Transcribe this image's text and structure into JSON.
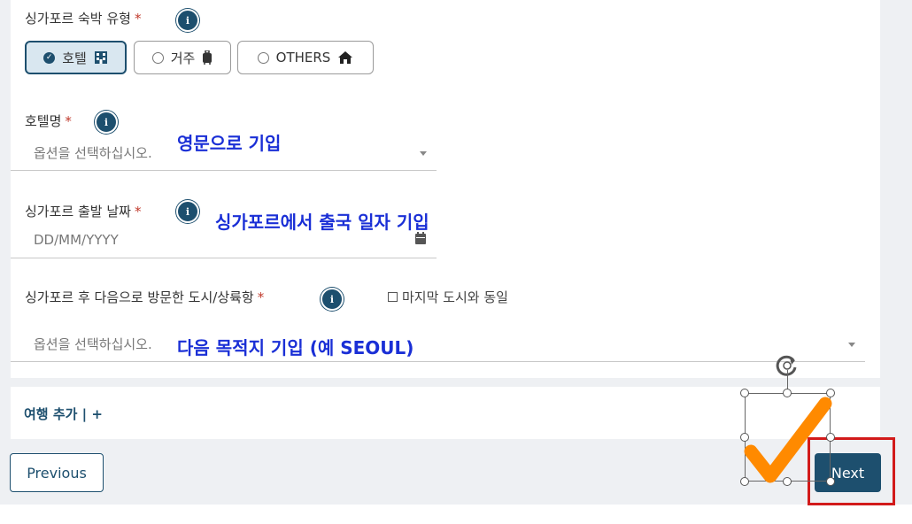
{
  "accommodation": {
    "label": "싱가포르 숙박 유형",
    "required_mark": "*",
    "info_icon": "info-icon",
    "options": [
      {
        "label": "호텔",
        "icon": "hotel-building-icon",
        "selected": true
      },
      {
        "label": "거주",
        "icon": "luggage-icon",
        "selected": false
      },
      {
        "label": "OTHERS",
        "icon": "home-icon",
        "selected": false
      }
    ]
  },
  "hotel_name": {
    "label": "호텔명",
    "required_mark": "*",
    "placeholder": "옵션을 선택하십시오.",
    "annotation": "영문으로 기입"
  },
  "departure_date": {
    "label": "싱가포르 출발 날짜",
    "required_mark": "*",
    "placeholder": "DD/MM/YYYY",
    "annotation": "싱가포르에서 출국 일자 기입"
  },
  "next_city": {
    "label": "싱가포르 후 다음으로 방문한 도시/상륙항",
    "required_mark": "*",
    "same_as_last_label": "마지막 도시와 동일",
    "placeholder": "옵션을 선택하십시오.",
    "annotation": "다음 목적지 기입 (예 SEOUL)"
  },
  "add_trip": {
    "label": "여행 추가 | +"
  },
  "nav": {
    "previous": "Previous",
    "next": "Next"
  },
  "colors": {
    "primary": "#1d4f6e",
    "annotation_blue": "#1a2fd6",
    "highlight_red": "#d21a1a",
    "checkmark_orange": "#ff8a00"
  }
}
